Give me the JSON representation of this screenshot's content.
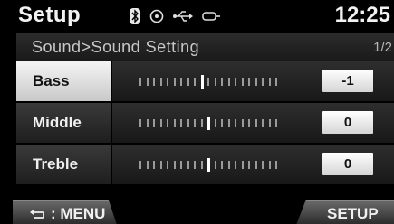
{
  "header": {
    "title": "Setup",
    "clock": "12:25",
    "icons": [
      "bluetooth-icon",
      "disc-icon",
      "usb-icon",
      "aux-icon"
    ]
  },
  "breadcrumb": {
    "path": "Sound>Sound Setting",
    "page": "1/2"
  },
  "rows": [
    {
      "label": "Bass",
      "value": "-1",
      "level": -1,
      "selected": true
    },
    {
      "label": "Middle",
      "value": "0",
      "level": 0,
      "selected": false
    },
    {
      "label": "Treble",
      "value": "0",
      "level": 0,
      "selected": false
    }
  ],
  "slider": {
    "min": -10,
    "max": 10
  },
  "footer": {
    "menu_label": "MENU",
    "menu_icon": "back-arrow-icon",
    "setup_label": "SETUP"
  }
}
